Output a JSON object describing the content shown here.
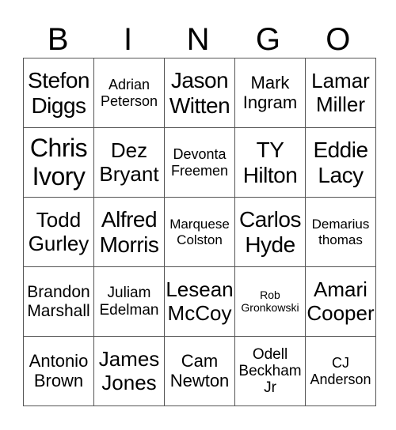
{
  "header": [
    "B",
    "I",
    "N",
    "G",
    "O"
  ],
  "rows": [
    [
      {
        "lines": [
          "Stefon",
          "Diggs"
        ],
        "size": "s28"
      },
      {
        "lines": [
          "Adrian",
          "Peterson"
        ],
        "size": "s18"
      },
      {
        "lines": [
          "Jason",
          "Witten"
        ],
        "size": "s28"
      },
      {
        "lines": [
          "Mark",
          "Ingram"
        ],
        "size": "s22"
      },
      {
        "lines": [
          "Lamar",
          "Miller"
        ],
        "size": "s26"
      }
    ],
    [
      {
        "lines": [
          "Chris",
          "Ivory"
        ],
        "size": "s32"
      },
      {
        "lines": [
          "Dez",
          "Bryant"
        ],
        "size": "s26"
      },
      {
        "lines": [
          "Devonta",
          "Freemen"
        ],
        "size": "s18"
      },
      {
        "lines": [
          "TY",
          "Hilton"
        ],
        "size": "s28"
      },
      {
        "lines": [
          "Eddie",
          "Lacy"
        ],
        "size": "s28"
      }
    ],
    [
      {
        "lines": [
          "Todd",
          "Gurley"
        ],
        "size": "s26"
      },
      {
        "lines": [
          "Alfred",
          "Morris"
        ],
        "size": "s28"
      },
      {
        "lines": [
          "Marquese",
          "Colston"
        ],
        "size": "s17"
      },
      {
        "lines": [
          "Carlos",
          "Hyde"
        ],
        "size": "s28"
      },
      {
        "lines": [
          "Demarius",
          "thomas"
        ],
        "size": "s17"
      }
    ],
    [
      {
        "lines": [
          "Brandon",
          "Marshall"
        ],
        "size": "s21"
      },
      {
        "lines": [
          "Juliam",
          "Edelman"
        ],
        "size": "s19"
      },
      {
        "lines": [
          "Lesean",
          "McCoy"
        ],
        "size": "s26"
      },
      {
        "lines": [
          "Rob",
          "Gronkowski"
        ],
        "size": "s14"
      },
      {
        "lines": [
          "Amari",
          "Cooper"
        ],
        "size": "s26"
      }
    ],
    [
      {
        "lines": [
          "Antonio",
          "Brown"
        ],
        "size": "s22"
      },
      {
        "lines": [
          "James",
          "Jones"
        ],
        "size": "s26"
      },
      {
        "lines": [
          "Cam",
          "Newton"
        ],
        "size": "s22"
      },
      {
        "lines": [
          "Odell",
          "Beckham",
          "Jr"
        ],
        "size": "s19"
      },
      {
        "lines": [
          "CJ",
          "Anderson"
        ],
        "size": "s18"
      }
    ]
  ]
}
